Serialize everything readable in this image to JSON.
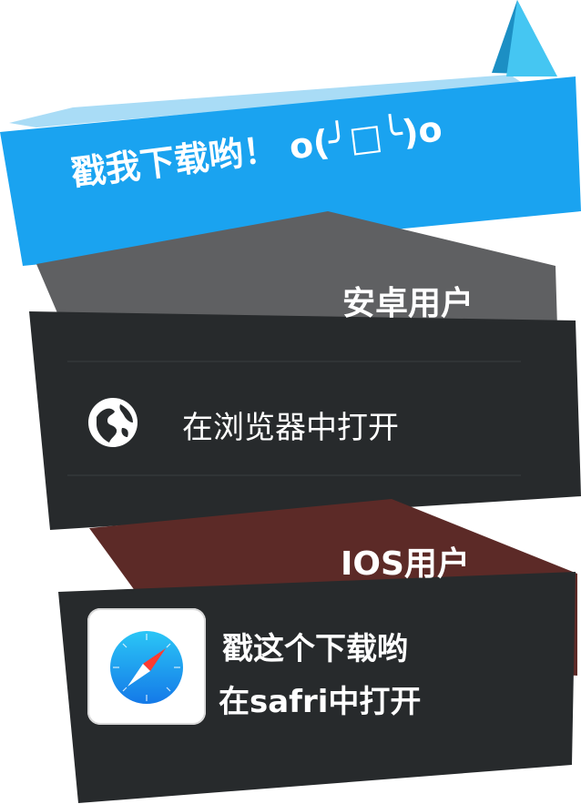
{
  "banner": {
    "title": "戳我下载哟！ o(╯□╰)o"
  },
  "android": {
    "heading": "安卓用户",
    "open_in_browser": "在浏览器中打开",
    "icon": "globe-icon"
  },
  "ios": {
    "heading": "IOS用户",
    "line1": "戳这个下载哟",
    "line2": "在safri中打开",
    "icon": "safari-compass-icon"
  },
  "colors": {
    "blue_ribbon": "#1aa3f0",
    "light_blue": "#7fd0f7",
    "dark_panel": "#272a2c",
    "gray_band": "#5f6062",
    "brown_band": "#5c2a27"
  }
}
